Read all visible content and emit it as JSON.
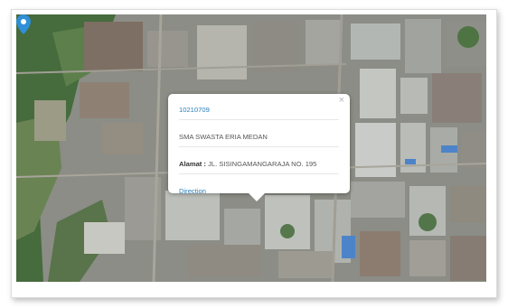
{
  "popup": {
    "id": "10210709",
    "name": "SMA SWASTA ERIA MEDAN",
    "address_label": "Alamat :",
    "address_value": "JL. SISINGAMANGARAJA NO. 195",
    "direction": "Direction",
    "close": "×"
  },
  "marker": {
    "color": "#2f8fd8",
    "icon": "map-pin-icon"
  },
  "colors": {
    "link": "#2a7fb8",
    "vegetation": "#3f6b3a",
    "roof": "#a7a9a4"
  }
}
